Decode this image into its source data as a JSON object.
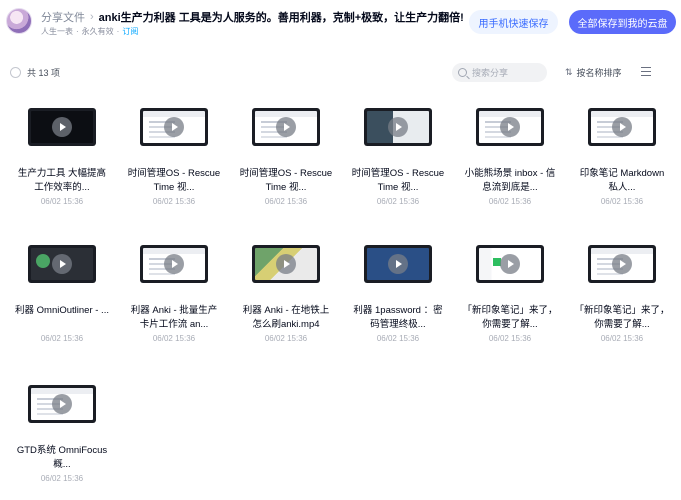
{
  "header": {
    "crumb_parent": "分享文件",
    "crumb_separator": "›",
    "title": "anki生产力利器 工具是为人服务的。善用利器，克制+极致，让生产力翻倍!",
    "sub_author": "人生一表",
    "sub_dot": "·",
    "sub_validity": "永久有效",
    "sub_dot2": "·",
    "sub_subscribe": "订阅",
    "btn_phone": "用手机快速保存",
    "btn_save_all": "全部保存到我的云盘"
  },
  "toolbar": {
    "count": "共 13 项",
    "search_placeholder": "搜索分享",
    "sort_label": "按名称排序",
    "sort_icon": "⇅"
  },
  "files": [
    {
      "name": "生产力工具 大幅提高工作效率的...",
      "date": "06/02 15:36",
      "thumb": "dark"
    },
    {
      "name": "时间管理OS - RescueTime 视...",
      "date": "06/02 15:36",
      "thumb": "light"
    },
    {
      "name": "时间管理OS - RescueTime 视...",
      "date": "06/02 15:36",
      "thumb": "light"
    },
    {
      "name": "时间管理OS - RescueTime 视...",
      "date": "06/02 15:36",
      "thumb": "mixed"
    },
    {
      "name": "小能熊场景 inbox - 信息流到底是...",
      "date": "06/02 15:36",
      "thumb": "light"
    },
    {
      "name": "印象笔记 Markdown 私人...",
      "date": "06/02 15:36",
      "thumb": "light"
    },
    {
      "name": "利器 OmniOutliner - ...",
      "date": "06/02 15:36",
      "thumb": "outliner"
    },
    {
      "name": "利器 Anki - 批量生产卡片工作流 an...",
      "date": "06/02 15:36",
      "thumb": "light"
    },
    {
      "name": "利器 Anki - 在地铁上怎么刷anki.mp4",
      "date": "06/02 15:36",
      "thumb": "colorful"
    },
    {
      "name": "利器 1password ：密码管理终极...",
      "date": "06/02 15:36",
      "thumb": "blue"
    },
    {
      "name": "「新印象笔记」来了，你需要了解...",
      "date": "06/02 15:36",
      "thumb": "green-note"
    },
    {
      "name": "「新印象笔记」来了，你需要了解...",
      "date": "06/02 15:36",
      "thumb": "light"
    },
    {
      "name": "GTD系统 OmniFocus概...",
      "date": "06/02 15:36",
      "thumb": "light"
    }
  ]
}
